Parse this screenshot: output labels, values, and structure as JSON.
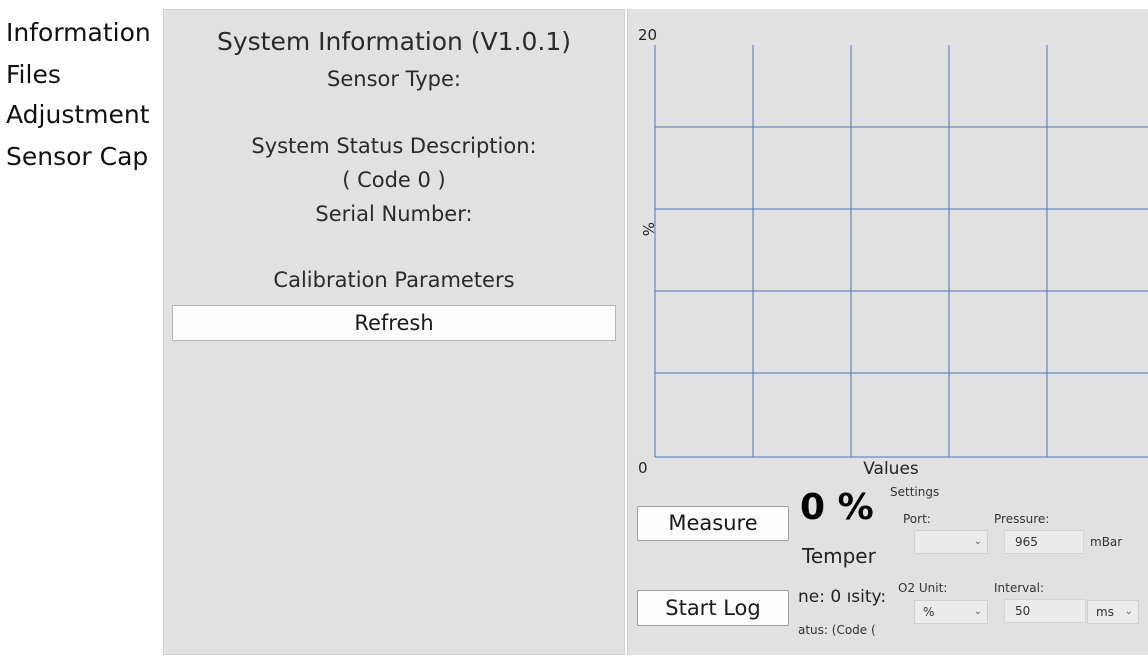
{
  "nav": {
    "items": [
      {
        "label": "Information"
      },
      {
        "label": "Files"
      },
      {
        "label": "Adjustment"
      },
      {
        "label": "Sensor Cap"
      }
    ]
  },
  "info": {
    "title": "System Information (V1.0.1)",
    "sensor_type_label": "Sensor Type:",
    "status_desc_label": "System Status Description:",
    "code_text": "( Code  0 )",
    "serial_label": "Serial Number:",
    "calibration_label": "Calibration Parameters",
    "refresh_label": "Refresh"
  },
  "chart_data": {
    "type": "line",
    "ylabel": "%",
    "xlabel": "Values",
    "ylim": [
      0,
      20
    ],
    "y_tick_labels": [
      "20",
      "0"
    ],
    "grid": true,
    "series": []
  },
  "measure": {
    "measure_label": "Measure",
    "start_log_label": "Start Log",
    "value_text": "0 %",
    "temper_text": "Temper",
    "line_text": "ne: 0 ısity:",
    "status_text": "atus:  (Code ("
  },
  "settings": {
    "title": "Settings",
    "port_label": "Port:",
    "port_value": "",
    "pressure_label": "Pressure:",
    "pressure_value": "965",
    "pressure_unit": "mBar",
    "o2_unit_label": "O2 Unit:",
    "o2_unit_value": "%",
    "interval_label": "Interval:",
    "interval_value": "50",
    "interval_unit": "ms"
  },
  "colors": {
    "grid": "#4a76b8",
    "panel": "#e1e1e1"
  }
}
